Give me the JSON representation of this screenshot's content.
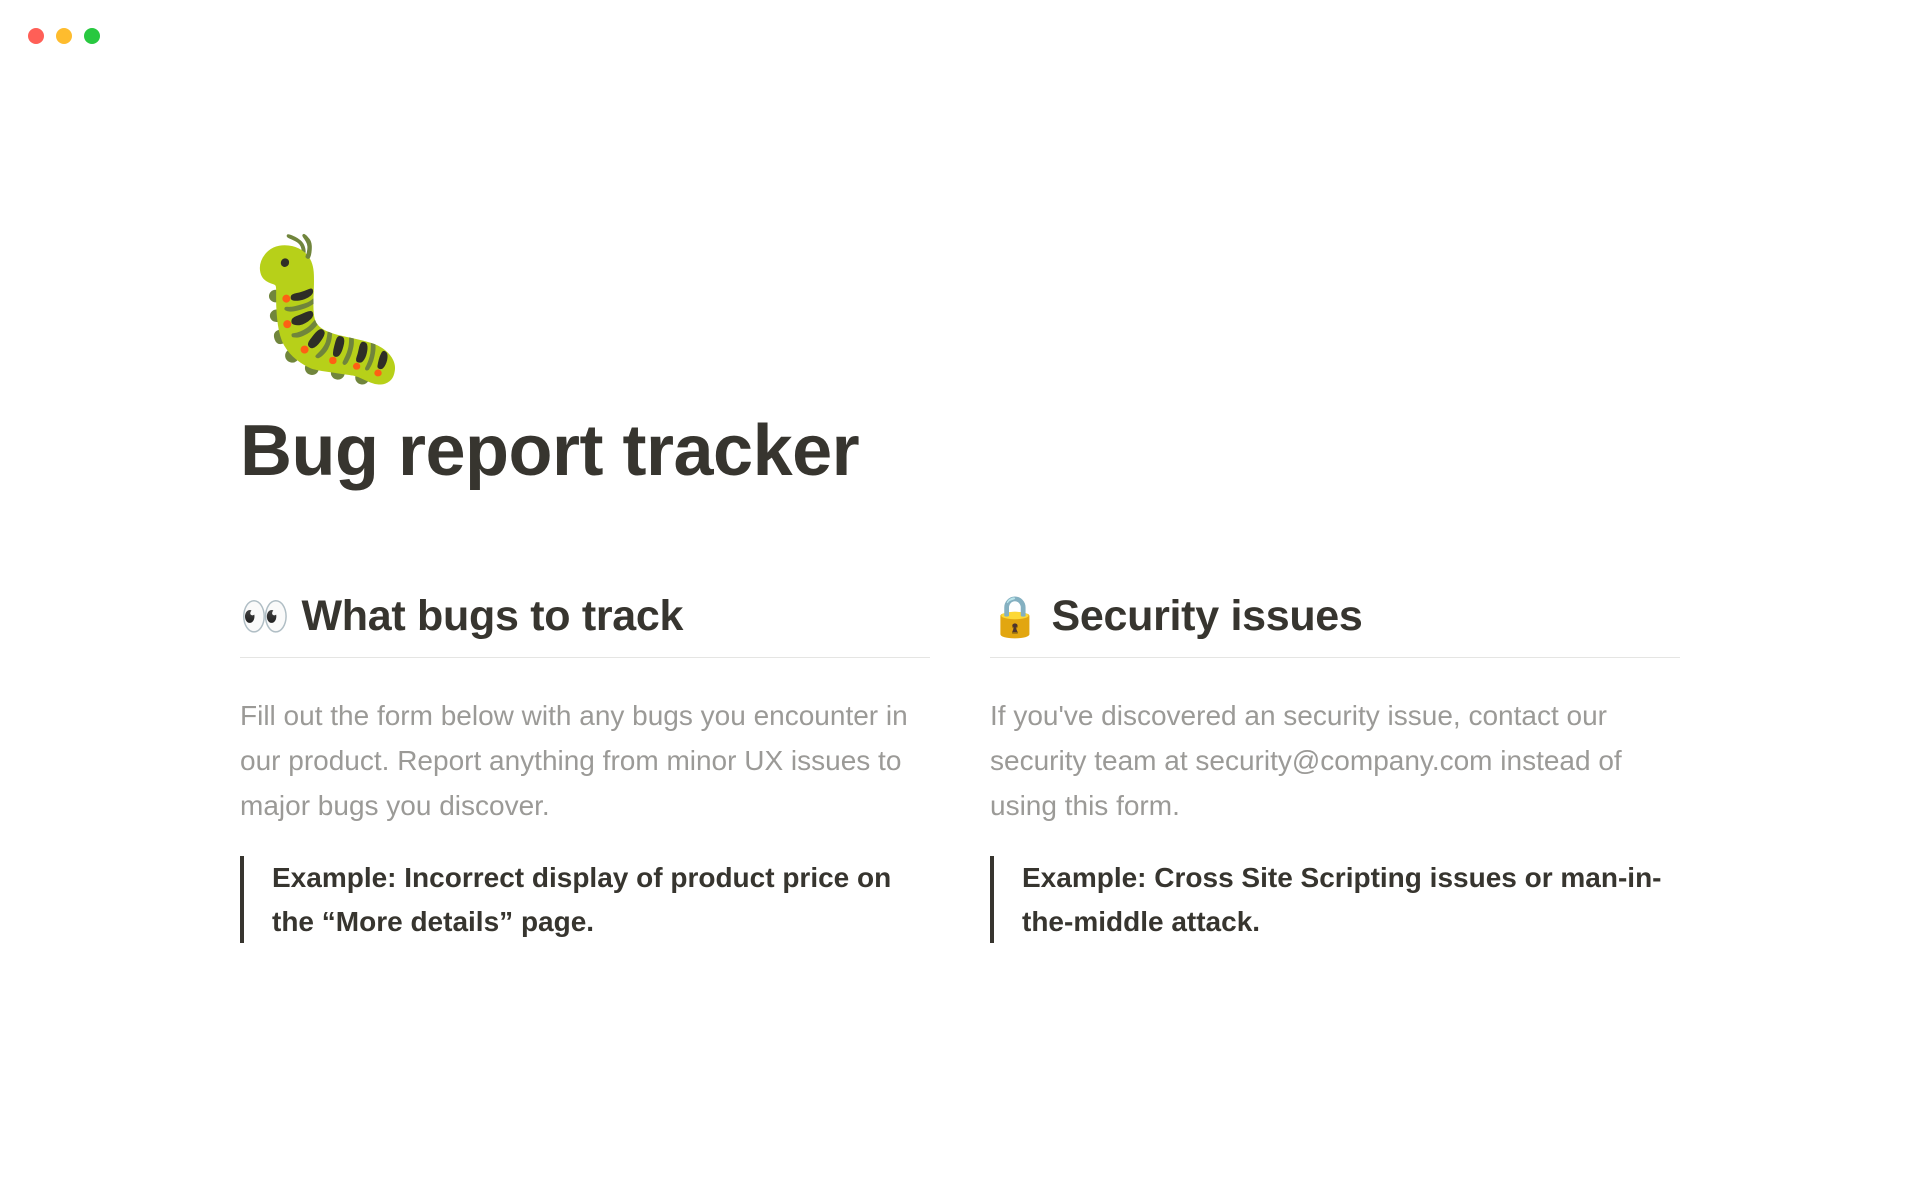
{
  "icons": {
    "page": "🐛",
    "eyes": "👀",
    "lock": "🔒"
  },
  "page": {
    "title": "Bug report tracker"
  },
  "sections": {
    "left": {
      "heading": "What bugs to track",
      "body": "Fill out the form below with any bugs you encounter in our product. Report anything from minor UX issues to major bugs you discover.",
      "callout": "Example: Incorrect display of product price on the “More details” page."
    },
    "right": {
      "heading": "Security issues",
      "body": "If you've discovered an security issue, contact our security team at security@company.com instead of using this form.",
      "callout": "Example: Cross Site Scripting issues or man-in-the-middle attack."
    }
  }
}
